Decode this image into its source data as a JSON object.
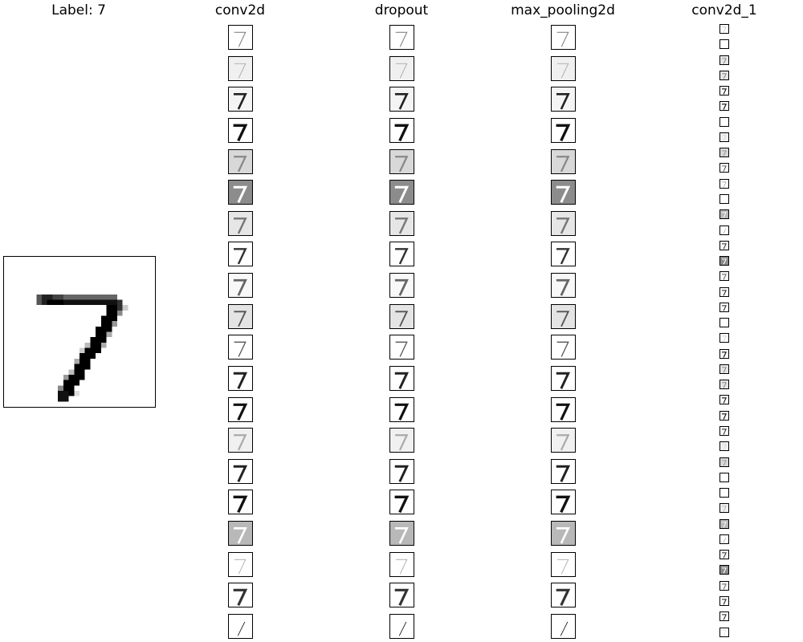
{
  "label_title": "Label: 7",
  "columns": [
    {
      "name": "conv2d",
      "title": "conv2d"
    },
    {
      "name": "dropout",
      "title": "dropout"
    },
    {
      "name": "max-pooling2d",
      "title": "max_pooling2d"
    },
    {
      "name": "conv2d-1",
      "title": "conv2d_1"
    }
  ],
  "map_count": 20,
  "small_map_count": 40,
  "map_styles": [
    {
      "bg": "#ffffff",
      "stroke": "#888888",
      "weight": 0.6
    },
    {
      "bg": "#f0f0f0",
      "stroke": "#aaaaaa",
      "weight": 0.5
    },
    {
      "bg": "#f4f4f4",
      "stroke": "#222222",
      "weight": 1.4
    },
    {
      "bg": "#ffffff",
      "stroke": "#111111",
      "weight": 1.8
    },
    {
      "bg": "#d8d8d8",
      "stroke": "#888888",
      "weight": 1.2
    },
    {
      "bg": "#8c8c8c",
      "stroke": "#ffffff",
      "weight": 1.6
    },
    {
      "bg": "#e6e6e6",
      "stroke": "#777777",
      "weight": 1.3
    },
    {
      "bg": "#ffffff",
      "stroke": "#333333",
      "weight": 1.3
    },
    {
      "bg": "#f8f8f8",
      "stroke": "#666666",
      "weight": 1.5
    },
    {
      "bg": "#e4e4e4",
      "stroke": "#555555",
      "weight": 1.0
    },
    {
      "bg": "#ffffff",
      "stroke": "#555555",
      "weight": 0.7
    },
    {
      "bg": "#ffffff",
      "stroke": "#222222",
      "weight": 1.6
    },
    {
      "bg": "#ffffff",
      "stroke": "#111111",
      "weight": 1.7
    },
    {
      "bg": "#f0f0f0",
      "stroke": "#aaaaaa",
      "weight": 1.2
    },
    {
      "bg": "#ffffff",
      "stroke": "#222222",
      "weight": 1.6
    },
    {
      "bg": "#ffffff",
      "stroke": "#111111",
      "weight": 1.8
    },
    {
      "bg": "#b8b8b8",
      "stroke": "#ffffff",
      "weight": 1.4
    },
    {
      "bg": "#ffffff",
      "stroke": "#999999",
      "weight": 0.4
    },
    {
      "bg": "#ffffff",
      "stroke": "#333333",
      "weight": 1.7
    },
    {
      "bg": "#ffffff",
      "stroke": "#222222",
      "weight": 0.5,
      "diag": true
    }
  ]
}
